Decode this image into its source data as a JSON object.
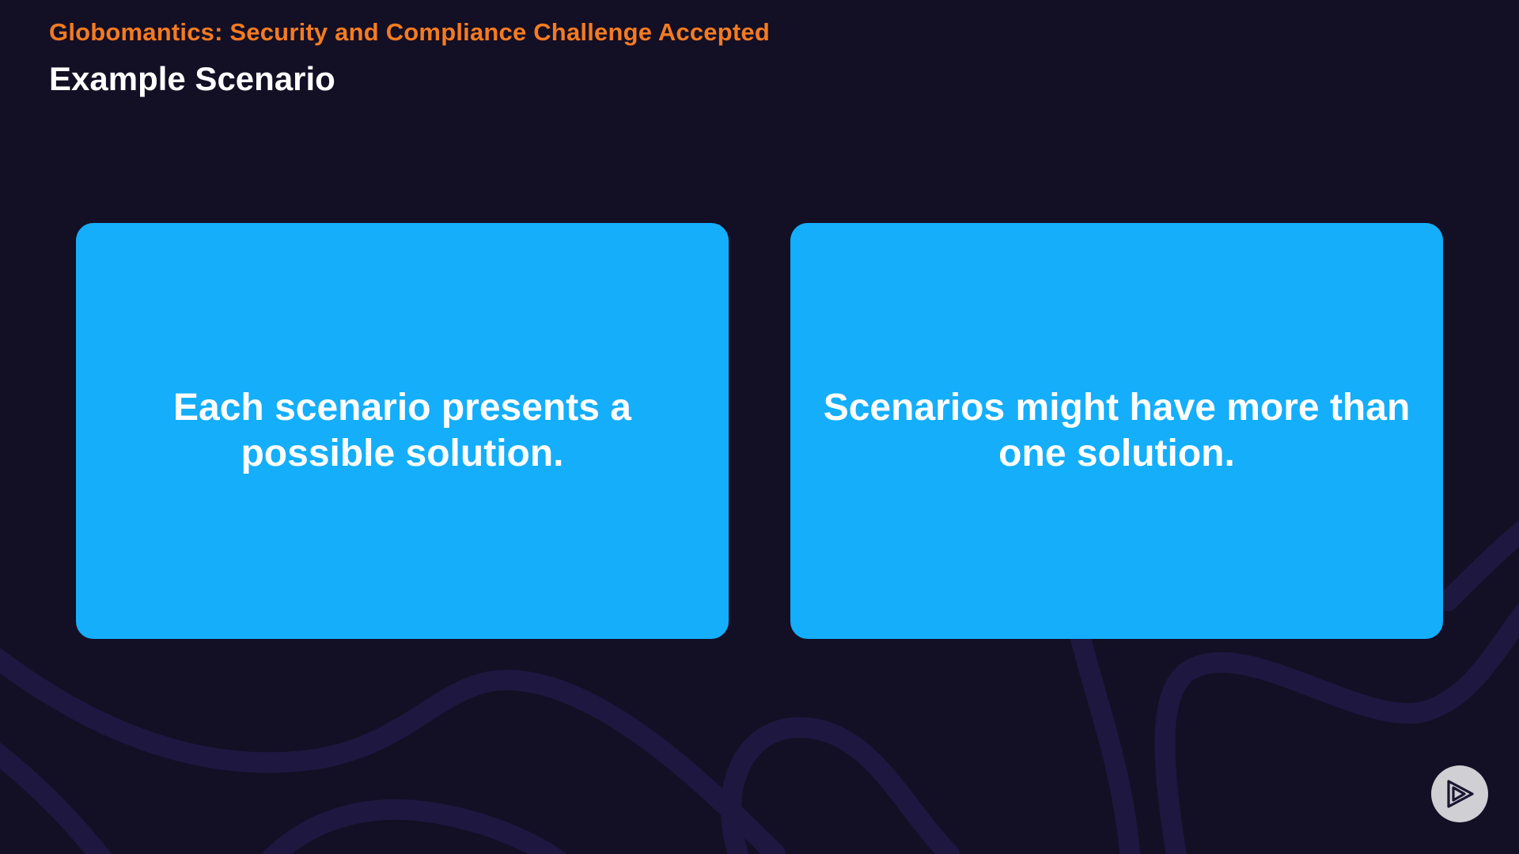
{
  "header": {
    "course_title": "Globomantics: Security and Compliance Challenge Accepted",
    "slide_title": "Example Scenario"
  },
  "cards": [
    {
      "text": "Each scenario presents a possible solution."
    },
    {
      "text": "Scenarios might have more than one solution."
    }
  ],
  "colors": {
    "background": "#130f25",
    "accent_orange": "#f47b20",
    "card_blue": "#14aefb",
    "decorative_lines": "#1e1840"
  },
  "icons": {
    "player_button": "play-logo-icon"
  }
}
